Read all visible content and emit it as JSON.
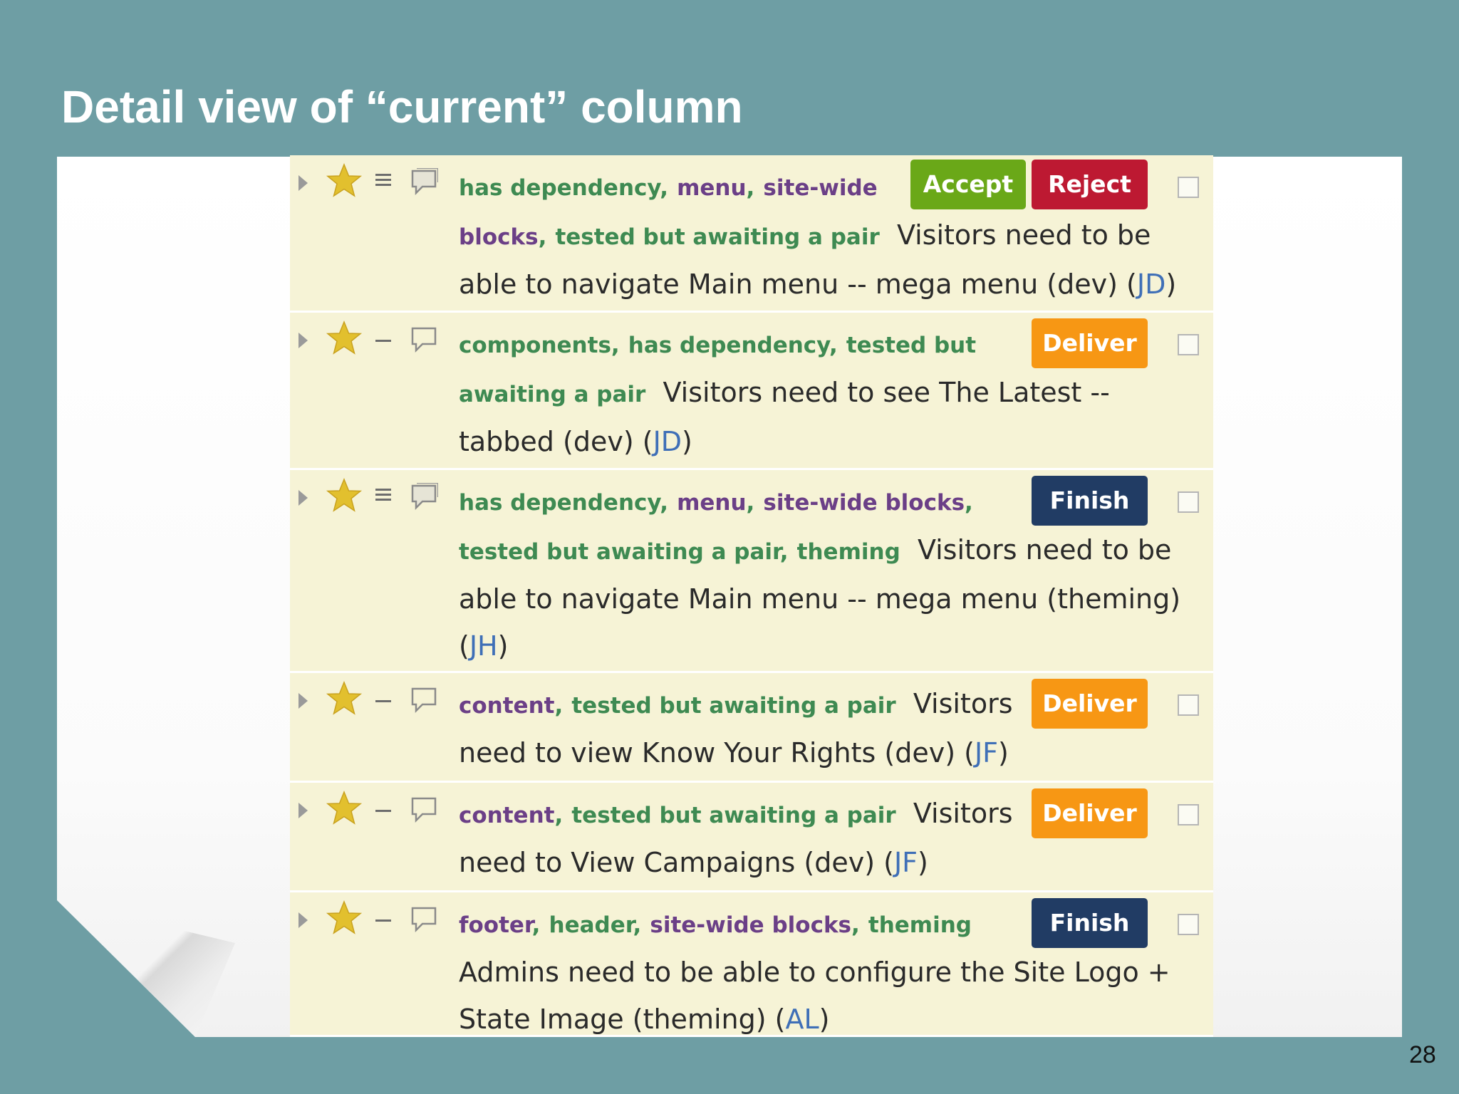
{
  "slide": {
    "title": "Detail view of “current” column",
    "page_number": "28"
  },
  "colors": {
    "slide_background": "#6e9ea4",
    "story_background": "#f6f3d6",
    "label_purple": "#6b3f87",
    "label_green": "#3e8a52",
    "owner_blue": "#3f6fb7",
    "accept": "#6aa818",
    "reject": "#bd1932",
    "deliver": "#f79714",
    "finish": "#213c64",
    "star": "#e2c02e"
  },
  "icons": {
    "expand": "chevron-right-icon",
    "priority": "star-icon",
    "estimate": "estimate-bars-icon",
    "comments": "comment-icon",
    "select": "checkbox-icon"
  },
  "stories": [
    {
      "labels": [
        "has dependency",
        "menu",
        "site-wide blocks",
        "tested but awaiting a pair"
      ],
      "label_colors": [
        "green",
        "purple",
        "purple",
        "green"
      ],
      "separator": ",",
      "text": "Visitors need to be able to navigate Main menu -- mega menu (dev)",
      "owner_prefix": "(",
      "owner": "JD",
      "owner_suffix": ")",
      "actions": [
        "Accept",
        "Reject"
      ],
      "estimate": 3,
      "has_comments": true
    },
    {
      "labels": [
        "components",
        "has dependency",
        "tested but awaiting a pair"
      ],
      "label_colors": [
        "green",
        "green",
        "green"
      ],
      "separator": ",",
      "text": "Visitors need to see The Latest -- tabbed (dev)",
      "owner_prefix": "(",
      "owner": "JD",
      "owner_suffix": ")",
      "actions": [
        "Deliver"
      ],
      "estimate": 1,
      "has_comments": false
    },
    {
      "labels": [
        "has dependency",
        "menu",
        "site-wide blocks",
        "tested but awaiting a pair",
        "theming"
      ],
      "label_colors": [
        "green",
        "purple",
        "purple",
        "green",
        "green"
      ],
      "separator": ",",
      "text": "Visitors need to be able to navigate Main menu -- mega menu (theming)",
      "owner_prefix": "(",
      "owner": "JH",
      "owner_suffix": ")",
      "actions": [
        "Finish"
      ],
      "estimate": 3,
      "has_comments": true
    },
    {
      "labels": [
        "content",
        "tested but awaiting a pair"
      ],
      "label_colors": [
        "purple",
        "green"
      ],
      "separator": ",",
      "text": "Visitors need to view Know Your Rights (dev)",
      "owner_prefix": "(",
      "owner": "JF",
      "owner_suffix": ")",
      "actions": [
        "Deliver"
      ],
      "estimate": 1,
      "has_comments": false
    },
    {
      "labels": [
        "content",
        "tested but awaiting a pair"
      ],
      "label_colors": [
        "purple",
        "green"
      ],
      "separator": ",",
      "text": "Visitors need to View Campaigns (dev)",
      "owner_prefix": "(",
      "owner": "JF",
      "owner_suffix": ")",
      "actions": [
        "Deliver"
      ],
      "estimate": 1,
      "has_comments": false
    },
    {
      "labels": [
        "footer",
        "header",
        "site-wide blocks",
        "theming"
      ],
      "label_colors": [
        "purple",
        "green",
        "purple",
        "green"
      ],
      "separator": ",",
      "text": "Admins need to be able to configure the Site Logo + State Image (theming)",
      "owner_prefix": "(",
      "owner": "AL",
      "owner_suffix": ")",
      "actions": [
        "Finish"
      ],
      "estimate": 1,
      "has_comments": false
    }
  ]
}
